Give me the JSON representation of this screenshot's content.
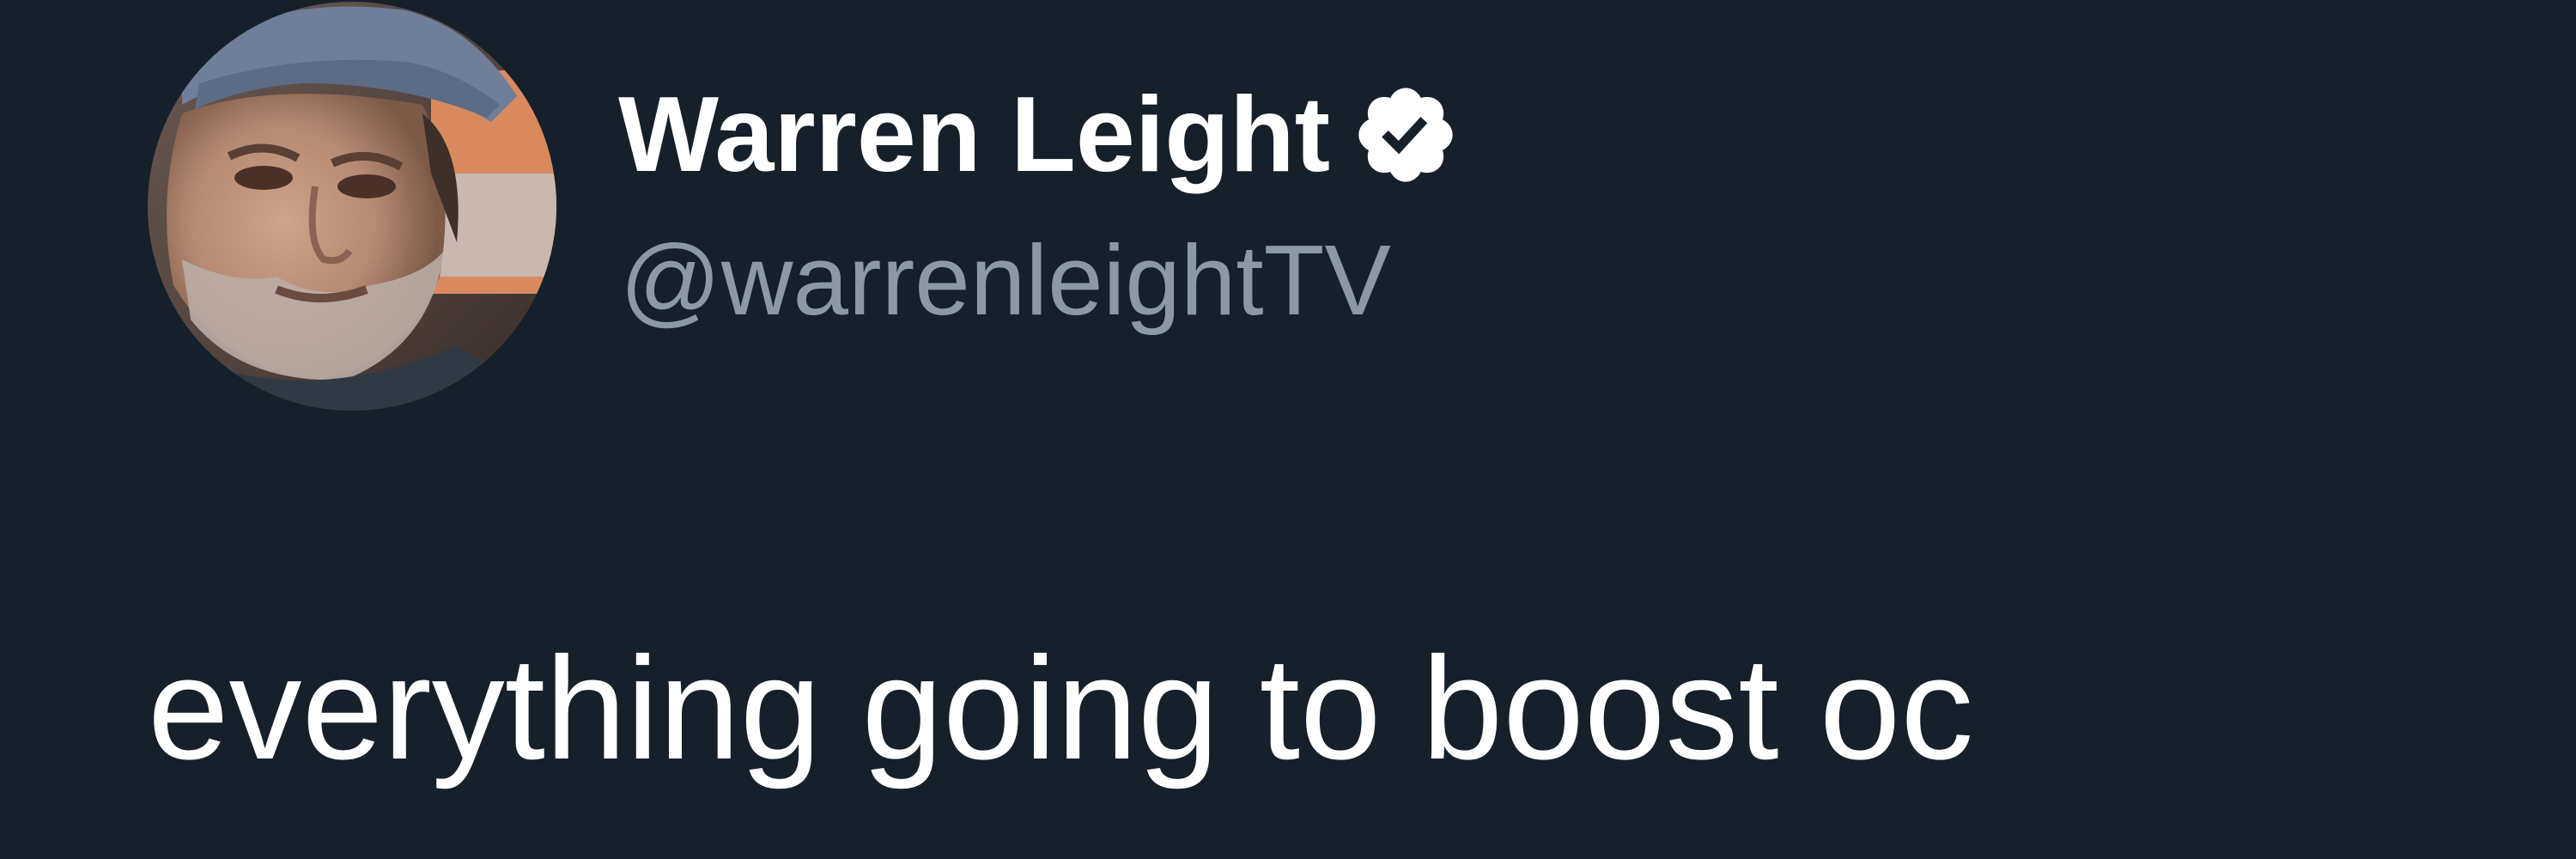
{
  "theme": {
    "background": "#15202b",
    "name_color": "#ffffff",
    "handle_color": "#8b98a5",
    "text_color": "#ffffff"
  },
  "author": {
    "display_name": "Warren Leight",
    "handle": "@warrenleightTV",
    "verified": true,
    "verified_icon": "verified-badge-icon",
    "avatar": "profile-photo"
  },
  "tweet": {
    "text": "everything going to boost oc"
  }
}
